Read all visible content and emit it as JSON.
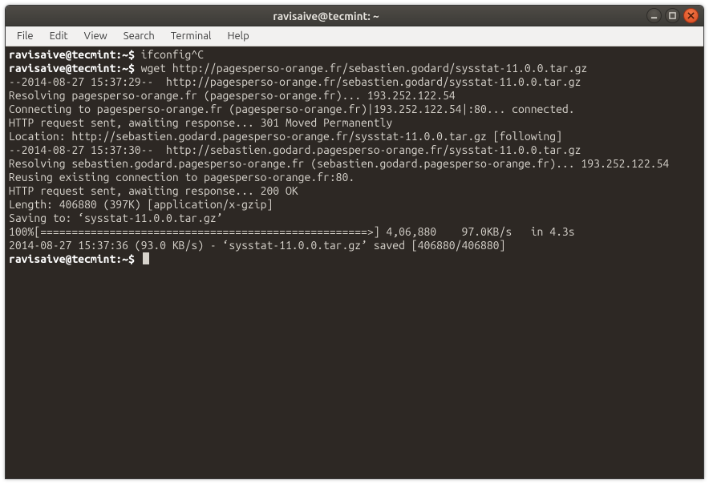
{
  "window": {
    "title": "ravisaive@tecmint: ~"
  },
  "menubar": {
    "items": [
      "File",
      "Edit",
      "View",
      "Search",
      "Terminal",
      "Help"
    ]
  },
  "terminal": {
    "prompt": "ravisaive@tecmint:~$",
    "lines": [
      {
        "p": true,
        "t": " ifconfig^C"
      },
      {
        "p": true,
        "t": " wget http://pagesperso-orange.fr/sebastien.godard/sysstat-11.0.0.tar.gz"
      },
      {
        "t": "--2014-08-27 15:37:29--  http://pagesperso-orange.fr/sebastien.godard/sysstat-11.0.0.tar.gz"
      },
      {
        "t": "Resolving pagesperso-orange.fr (pagesperso-orange.fr)... 193.252.122.54"
      },
      {
        "t": "Connecting to pagesperso-orange.fr (pagesperso-orange.fr)|193.252.122.54|:80... connected."
      },
      {
        "t": "HTTP request sent, awaiting response... 301 Moved Permanently"
      },
      {
        "t": "Location: http://sebastien.godard.pagesperso-orange.fr/sysstat-11.0.0.tar.gz [following]"
      },
      {
        "t": "--2014-08-27 15:37:30--  http://sebastien.godard.pagesperso-orange.fr/sysstat-11.0.0.tar.gz"
      },
      {
        "t": "Resolving sebastien.godard.pagesperso-orange.fr (sebastien.godard.pagesperso-orange.fr)... 193.252.122.54"
      },
      {
        "t": "Reusing existing connection to pagesperso-orange.fr:80."
      },
      {
        "t": "HTTP request sent, awaiting response... 200 OK"
      },
      {
        "t": "Length: 406880 (397K) [application/x-gzip]"
      },
      {
        "t": "Saving to: ‘sysstat-11.0.0.tar.gz’"
      },
      {
        "t": ""
      },
      {
        "t": "100%[====================================================>] 4,06,880    97.0KB/s   in 4.3s"
      },
      {
        "t": ""
      },
      {
        "t": "2014-08-27 15:37:36 (93.0 KB/s) - ‘sysstat-11.0.0.tar.gz’ saved [406880/406880]"
      },
      {
        "t": ""
      },
      {
        "p": true,
        "t": " ",
        "cursor": true
      }
    ]
  }
}
